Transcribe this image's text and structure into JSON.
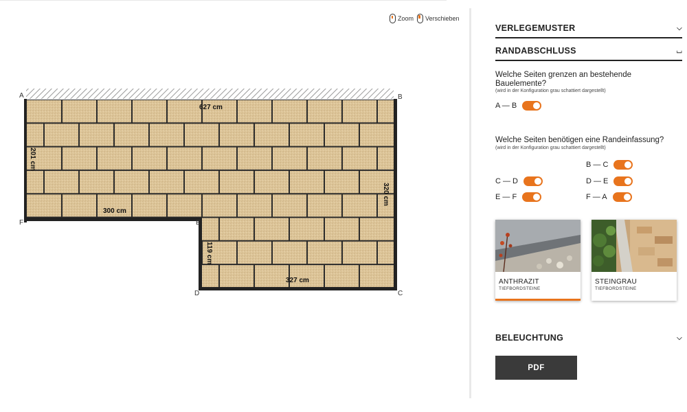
{
  "canvas": {
    "hints": {
      "zoom": "Zoom",
      "pan": "Verschieben"
    },
    "corners": {
      "a": "A",
      "b": "B",
      "c": "C",
      "d": "D",
      "e": "E",
      "f": "F"
    },
    "dimensions": {
      "top": "627 cm",
      "left": "201 cm",
      "right": "320 cm",
      "inner_horizontal": "300 cm",
      "inner_vertical": "119 cm",
      "bottom": "327 cm"
    }
  },
  "panel": {
    "verlegemuster": {
      "title": "VERLEGEMUSTER",
      "expanded": false
    },
    "randabschluss": {
      "title": "RANDABSCHLUSS",
      "expanded": true,
      "q1": "Welche Seiten grenzen an bestehende Bauelemente?",
      "q1_note": "(wird in der Konfiguration grau schattiert dargestellt)",
      "q1_toggles": [
        {
          "label": "A — B",
          "on": true
        }
      ],
      "q2": "Welche Seiten benötigen eine Randeinfassung?",
      "q2_note": "(wird in der Konfiguration grau schattiert dargestellt)",
      "q2_toggles": {
        "bc": {
          "label": "B — C",
          "on": true
        },
        "cd": {
          "label": "C — D",
          "on": true
        },
        "de": {
          "label": "D — E",
          "on": true
        },
        "ef": {
          "label": "E — F",
          "on": true
        },
        "fa": {
          "label": "F — A",
          "on": true
        }
      },
      "options": [
        {
          "name": "ANTHRAZIT",
          "sub": "TIEFBORDSTEINE",
          "selected": true
        },
        {
          "name": "STEINGRAU",
          "sub": "TIEFBORDSTEINE",
          "selected": false
        }
      ]
    },
    "beleuchtung": {
      "title": "BELEUCHTUNG",
      "expanded": false
    },
    "pdf_label": "PDF"
  },
  "colors": {
    "accent": "#e8741d",
    "paver": "#ddc59a",
    "border": "#222222",
    "button": "#3a3a3a"
  }
}
